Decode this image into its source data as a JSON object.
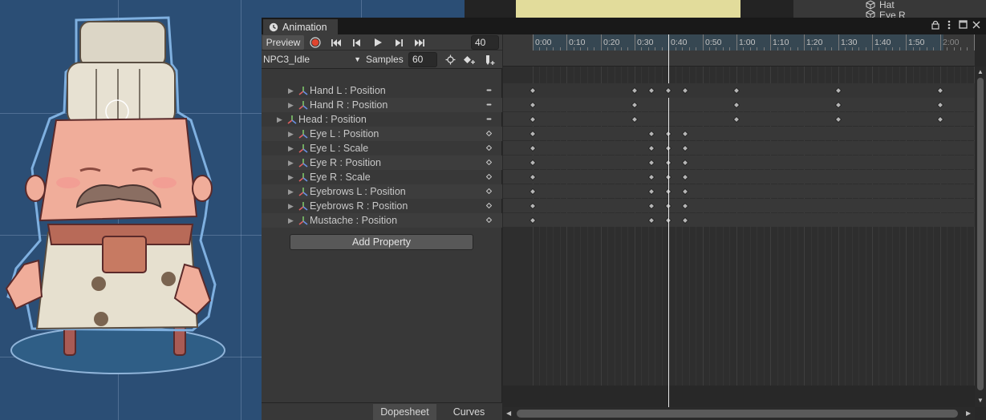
{
  "scene": {
    "name": "scene-view"
  },
  "hierarchy": {
    "items": [
      {
        "label": "Hat"
      },
      {
        "label": "Eye R"
      }
    ]
  },
  "window": {
    "tab_title": "Animation",
    "lock_icon": "lock-icon",
    "menu_icon": "kebab-menu-icon",
    "maximize_icon": "maximize-icon",
    "close_icon": "close-icon"
  },
  "controls": {
    "preview_label": "Preview",
    "frame_value": "40",
    "clip_name": "NPC3_Idle",
    "samples_label": "Samples",
    "samples_value": "60"
  },
  "timeline": {
    "labels": [
      "0:00",
      "0:10",
      "0:20",
      "0:30",
      "0:40",
      "0:50",
      "1:00",
      "1:10",
      "1:20",
      "1:30",
      "1:40",
      "1:50",
      "2:00"
    ],
    "playhead_time": "0:40",
    "summary_keys": [
      "0:00",
      "0:30",
      "0:35",
      "0:40",
      "0:45",
      "1:00",
      "1:30",
      "2:00"
    ]
  },
  "properties": [
    {
      "label": "Hand L : Position",
      "expand": true,
      "keys": [
        "0:00",
        "0:30",
        "1:00",
        "1:30",
        "2:00"
      ]
    },
    {
      "label": "Hand R : Position",
      "expand": true,
      "keys": [
        "0:00",
        "0:30",
        "1:00",
        "1:30",
        "2:00"
      ]
    },
    {
      "label": "Head : Position",
      "expand": false,
      "keys": [
        "0:00",
        "0:30",
        "1:00",
        "1:30",
        "2:00"
      ]
    },
    {
      "label": "Eye L : Position",
      "expand": true,
      "keys": [
        "0:00",
        "0:35",
        "0:40",
        "0:45"
      ]
    },
    {
      "label": "Eye L : Scale",
      "expand": true,
      "keys": [
        "0:00",
        "0:35",
        "0:40",
        "0:45"
      ]
    },
    {
      "label": "Eye R : Position",
      "expand": true,
      "keys": [
        "0:00",
        "0:35",
        "0:40",
        "0:45"
      ]
    },
    {
      "label": "Eye R : Scale",
      "expand": true,
      "keys": [
        "0:00",
        "0:35",
        "0:40",
        "0:45"
      ]
    },
    {
      "label": "Eyebrows L : Position",
      "expand": true,
      "keys": [
        "0:00",
        "0:35",
        "0:40",
        "0:45"
      ]
    },
    {
      "label": "Eyebrows R : Position",
      "expand": true,
      "keys": [
        "0:00",
        "0:35",
        "0:40",
        "0:45"
      ]
    },
    {
      "label": "Mustache : Position",
      "expand": true,
      "keys": [
        "0:00",
        "0:35",
        "0:40",
        "0:45"
      ]
    }
  ],
  "add_property_label": "Add Property",
  "bottom_tabs": {
    "dopesheet": "Dopesheet",
    "curves": "Curves"
  },
  "colors": {
    "record": "#e0452f",
    "keyframe": "#b5b5b5",
    "ruler_highlight": "#364752",
    "scene_bg": "#2b4e75"
  }
}
